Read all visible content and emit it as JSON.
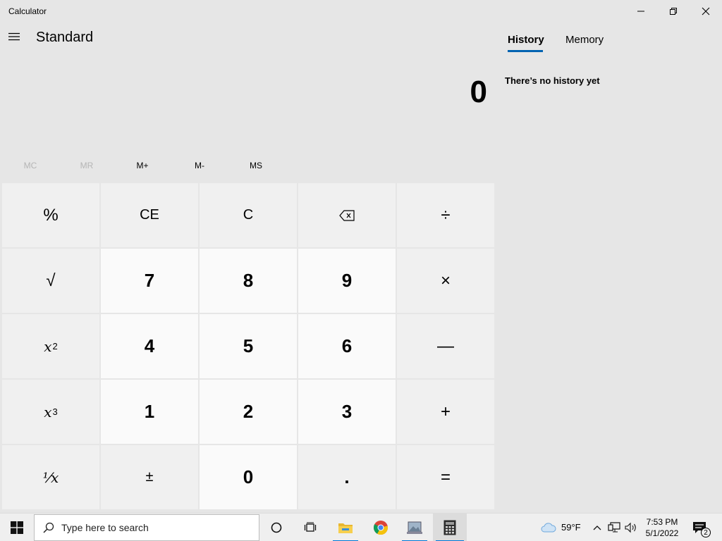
{
  "window": {
    "title": "Calculator",
    "minimize_icon": "minimize-icon",
    "restore_icon": "restore-icon",
    "close_icon": "close-icon"
  },
  "header": {
    "menu_icon": "hamburger-icon",
    "mode": "Standard"
  },
  "display": {
    "value": "0"
  },
  "side_panel": {
    "tabs": [
      {
        "label": "History",
        "active": true
      },
      {
        "label": "Memory",
        "active": false
      }
    ],
    "empty_message": "There’s no history yet",
    "accent_color": "#0063b1"
  },
  "memory": {
    "buttons": [
      {
        "label": "MC",
        "enabled": false
      },
      {
        "label": "MR",
        "enabled": false
      },
      {
        "label": "M+",
        "enabled": true
      },
      {
        "label": "M-",
        "enabled": true
      },
      {
        "label": "MS",
        "enabled": true
      }
    ]
  },
  "keypad": {
    "percent": "%",
    "ce": "CE",
    "c": "C",
    "backspace_icon": "backspace-icon",
    "divide": "÷",
    "sqrt": "√",
    "square_base": "x",
    "square_exp": "2",
    "cube_base": "x",
    "cube_exp": "3",
    "reciprocal": "⅟x",
    "multiply": "×",
    "minus": "—",
    "plus": "+",
    "plus_minus": "±",
    "decimal": ".",
    "equals": "=",
    "digits": {
      "d0": "0",
      "d1": "1",
      "d2": "2",
      "d3": "3",
      "d4": "4",
      "d5": "5",
      "d6": "6",
      "d7": "7",
      "d8": "8",
      "d9": "9"
    }
  },
  "taskbar": {
    "search_placeholder": "Type here to search",
    "apps": [
      "windows-start-icon",
      "search-icon",
      "cortana-icon",
      "task-view-icon",
      "file-explorer-icon",
      "chrome-icon",
      "photos-app-icon",
      "calculator-app-icon"
    ],
    "weather": "59°F",
    "time": "7:53 PM",
    "date": "5/1/2022",
    "notification_count": "2",
    "active_color": "#0078d7"
  }
}
